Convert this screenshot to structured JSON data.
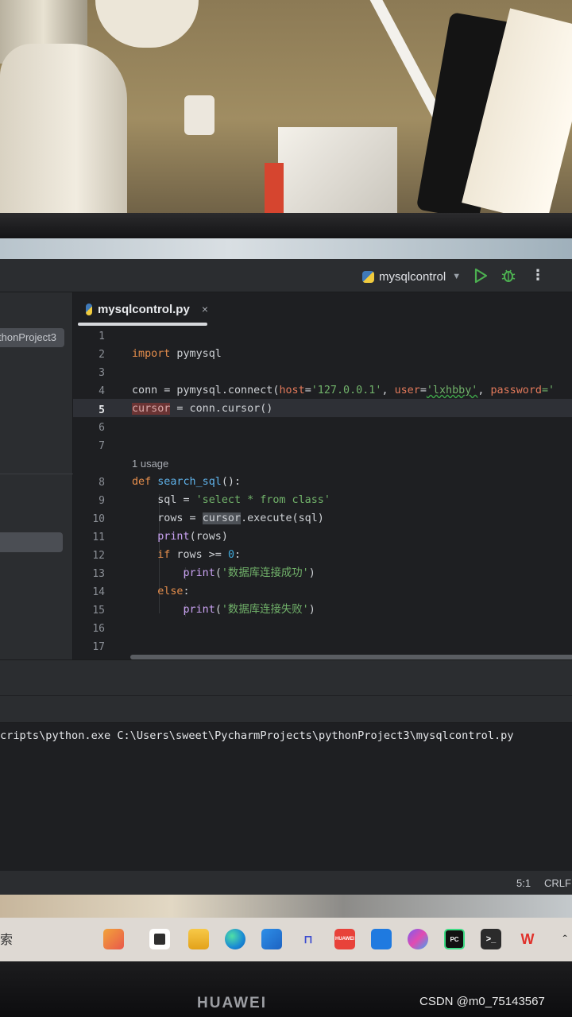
{
  "toolbar": {
    "run_config": "mysqlcontrol",
    "accent": "#4caf50"
  },
  "sidebar": {
    "project_label": "thonProject3"
  },
  "tab": {
    "label": "mysqlcontrol.py",
    "close": "×"
  },
  "editor": {
    "line_numbers": [
      "1",
      "2",
      "3",
      "4",
      "5",
      "6",
      "7",
      "8",
      "9",
      "10",
      "11",
      "12",
      "13",
      "14",
      "15",
      "16",
      "17"
    ],
    "current_line": "5",
    "usage_hint": "1 usage",
    "lines": {
      "l2": [
        "import",
        " pymysql"
      ],
      "l4": [
        "conn = pymysql.connect(",
        "host",
        "=",
        "'127.0.0.1'",
        ", ",
        "user",
        "=",
        "'lxhbby'",
        ", ",
        "password",
        "='"
      ],
      "l5": [
        "cursor",
        " = conn.cursor()"
      ],
      "l8": [
        "def",
        " ",
        "search_sql",
        "():"
      ],
      "l9": [
        "    sql = ",
        "'select * from class'"
      ],
      "l10": [
        "    rows = ",
        "cursor",
        ".execute(sql)"
      ],
      "l11": [
        "    ",
        "print",
        "(rows)"
      ],
      "l12": [
        "    ",
        "if",
        " rows >= ",
        "0",
        ":"
      ],
      "l13": [
        "        ",
        "print",
        "(",
        "'数据库连接成功'",
        ")"
      ],
      "l14": [
        "    ",
        "else",
        ":"
      ],
      "l15": [
        "        ",
        "print",
        "(",
        "'数据库连接失败'",
        ")"
      ]
    }
  },
  "console": {
    "command": "cripts\\python.exe C:\\Users\\sweet\\PycharmProjects\\pythonProject3\\mysqlcontrol.py"
  },
  "statusbar": {
    "position": "5:1",
    "line_ending": "CRLF"
  },
  "taskbar": {
    "search_label": "索",
    "icons": [
      "widgets-icon",
      "taskview-icon",
      "file-explorer-icon",
      "edge-icon",
      "store-icon",
      "mail-icon",
      "huawei-app-icon",
      "cloud-icon",
      "copilot-icon",
      "pycharm-icon",
      "terminal-icon",
      "wps-icon",
      "chevron-up-icon"
    ],
    "huawei_app_label": "HUAWEI",
    "pycharm_label": "PC"
  },
  "device": {
    "brand": "HUAWEI"
  },
  "watermark": "CSDN @m0_75143567"
}
